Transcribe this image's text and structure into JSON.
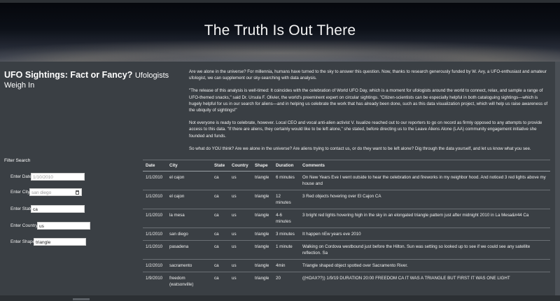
{
  "hero": {
    "title": "The Truth Is Out There"
  },
  "heading": {
    "title": "UFO Sightings: Fact or Fancy?",
    "subtitle": "Ufologists Weigh In"
  },
  "intro": [
    "Are we alone in the universe? For millennia, humans have turned to the sky to answer this question. Now, thanks to research generously funded by W. Avy, a UFO-enthusiast and amateur ufologist, we can supplement our sky-searching with data analysis.",
    "\"The release of this analysis is well-timed: It coincides with the celebration of World UFO Day, which is a moment for ufologists around the world to connect, relax, and sample a range of UFO-themed snacks,\" said Dr. Ursula F. Olivier, the world's preeminent expert on circular sightings. \"Citizen-scientists can be especially helpful in both cataloguing sightings—which is hugely helpful for us in our search for aliens—and in helping us celebrate the work that has already been done, such as this data visualization project, which will help us raise awareness of the ubiquity of sightings!\"",
    "Not everyone is ready to celebrate, however. Local CEO and vocal anti-alien activist V. Isualize reached out to our reporters to go on record as firmly opposed to any attempts to provide access to this data. \"If there are aliens, they certainly would like to be left alone,\" she stated, before directing us to the Leave Aliens Alone (LAA) community engagement initiative she founded and funds.",
    "So what do YOU think? Are we alone in the universe? Are aliens trying to contact us, or do they want to be left alone? Dig through the data yourself, and let us know what you see."
  ],
  "filters": {
    "title": "Filter Search",
    "date": {
      "label": "Enter Date",
      "value": "",
      "placeholder": "1/10/2010"
    },
    "city": {
      "label": "Enter City",
      "value": "",
      "placeholder": "san diego"
    },
    "state": {
      "label": "Enter State",
      "value": "ca",
      "placeholder": ""
    },
    "country": {
      "label": "Enter Country",
      "value": "us",
      "placeholder": ""
    },
    "shape": {
      "label": "Enter Shape",
      "value": "triangle",
      "placeholder": ""
    }
  },
  "table": {
    "headers": [
      "Date",
      "City",
      "State",
      "Country",
      "Shape",
      "Duration",
      "Comments"
    ],
    "rows": [
      [
        "1/1/2010",
        "el cajon",
        "ca",
        "us",
        "triangle",
        "6 minutes",
        "On New Years Eve I went outside to hear the celebration and fireworks in my neighbor hood. And noticed 3 red lights above my house and"
      ],
      [
        "1/1/2010",
        "el cajon",
        "ca",
        "us",
        "triangle",
        "12 minutes",
        "3 Red objects hovering over El Cajon CA"
      ],
      [
        "1/1/2010",
        "la mesa",
        "ca",
        "us",
        "triangle",
        "4-6 minutes",
        "3 bright red lights hovering high in the sky in an elongated triangle pattern just after midnight 2010 in La Mesa&#44 Ca"
      ],
      [
        "1/1/2010",
        "san diego",
        "ca",
        "us",
        "triangle",
        "3 minutes",
        "It happen nEw years eve 2010"
      ],
      [
        "1/1/2010",
        "pasadena",
        "ca",
        "us",
        "triangle",
        "1 minute",
        "Walking on Cordova westbound just before the Hilton. Sun was setting so looked up to see if we could see any satellite reflection. Sa"
      ],
      [
        "1/2/2010",
        "sacramento",
        "ca",
        "us",
        "triangle",
        "4min",
        "Triangle shaped object spotted over Sacramento River."
      ],
      [
        "1/9/2010",
        "freedom (watsonville)",
        "ca",
        "us",
        "triangle",
        "20",
        "((HOAX??)) 1/9/19 DURATION 20:00 FREEDOM CA IT WAS A TRIANGLE BUT FIRST IT WAS ONE LIGHT"
      ]
    ]
  }
}
